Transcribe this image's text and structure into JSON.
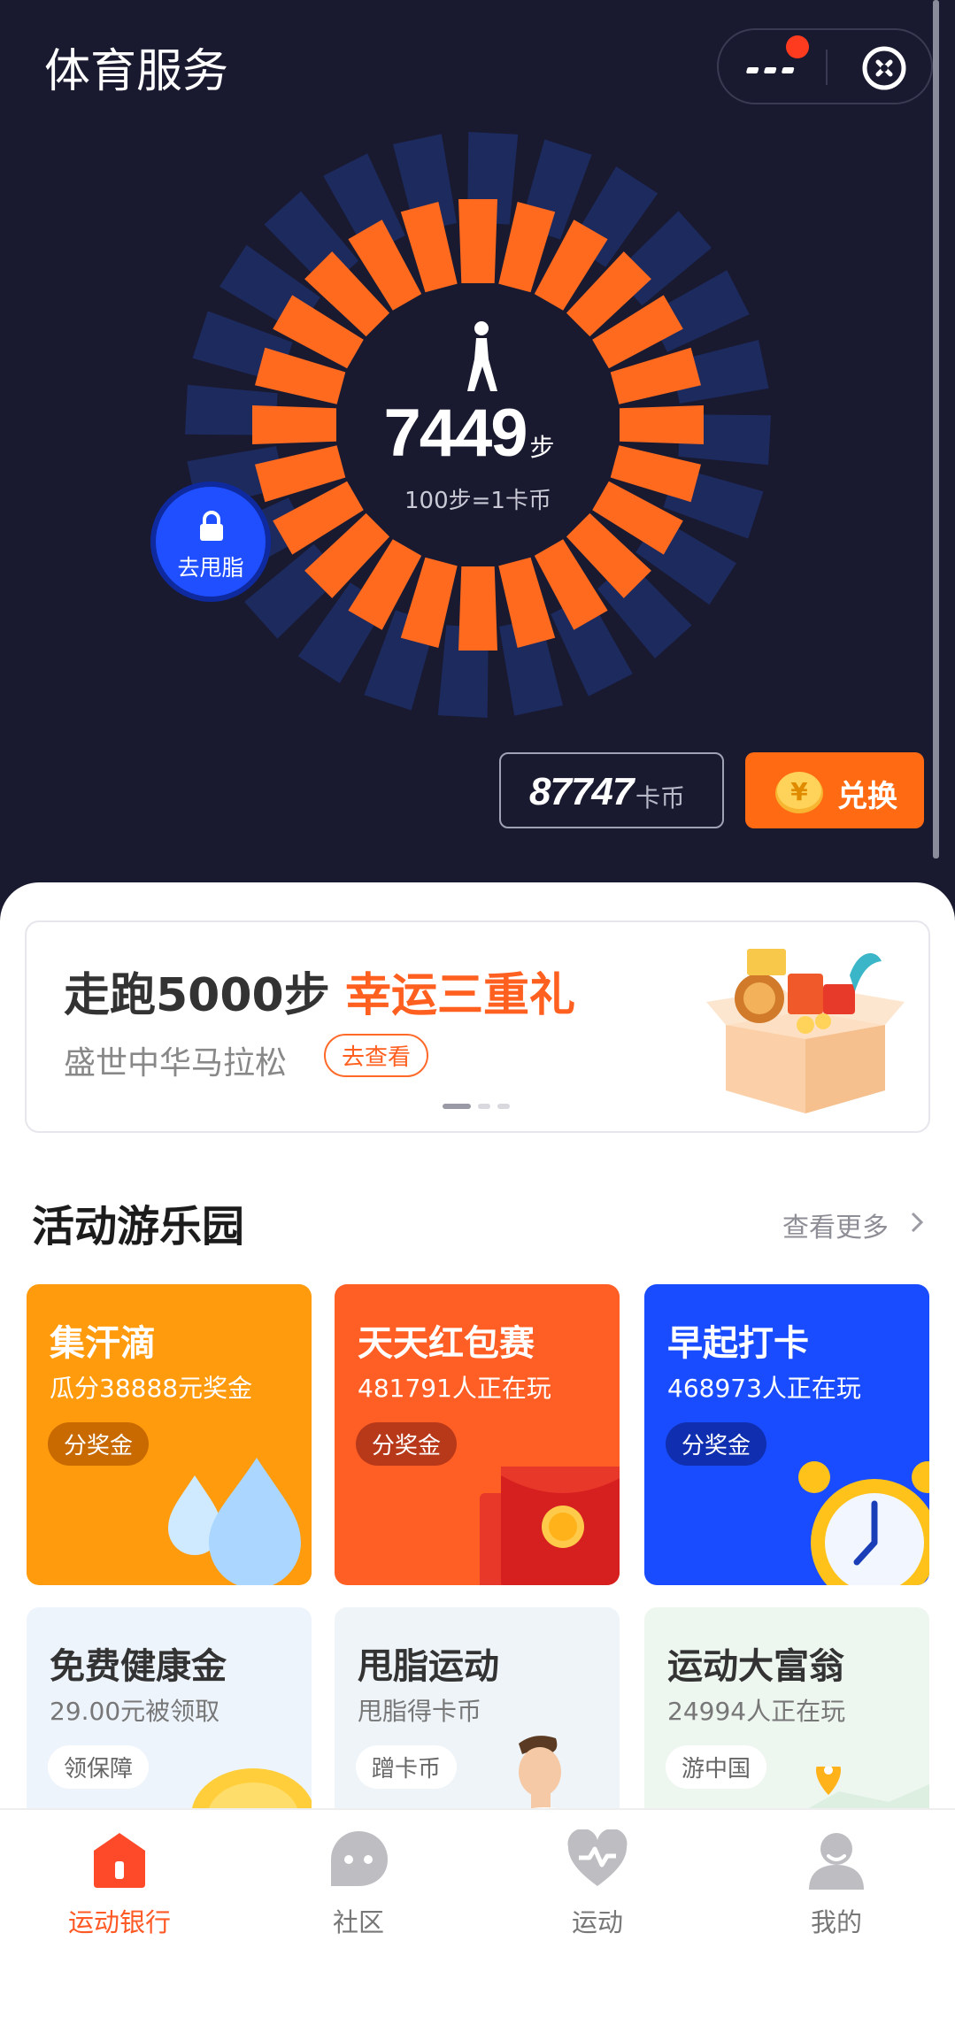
{
  "header": {
    "title": "体育服务"
  },
  "steps": {
    "value": "7449",
    "unit": "步",
    "rate": "100步=1卡币",
    "progress_fraction": 0.45
  },
  "lock_button": {
    "label": "去甩脂"
  },
  "balance": {
    "value": "87747",
    "unit": "卡币"
  },
  "exchange_button": {
    "label": "兑换"
  },
  "banner": {
    "title_black": "走跑5000步",
    "title_orange": "幸运三重礼",
    "subtitle": "盛世中华马拉松",
    "chip": "去查看",
    "active_page": 1,
    "page_count": 3
  },
  "section": {
    "title": "活动游乐园",
    "more": "查看更多"
  },
  "cards": [
    {
      "title": "集汗滴",
      "subtitle": "瓜分38888元奖金",
      "badge": "分奖金",
      "icon": "water-drop-icon"
    },
    {
      "title": "天天红包赛",
      "subtitle": "481791人正在玩",
      "badge": "分奖金",
      "icon": "red-envelope-icon"
    },
    {
      "title": "早起打卡",
      "subtitle": "468973人正在玩",
      "badge": "分奖金",
      "icon": "alarm-clock-icon"
    },
    {
      "title": "免费健康金",
      "subtitle": "29.00元被领取",
      "badge": "领保障",
      "icon": "gold-coin-icon"
    },
    {
      "title": "甩脂运动",
      "subtitle": "甩脂得卡币",
      "badge": "蹭卡币",
      "icon": "trainer-avatar-icon"
    },
    {
      "title": "运动大富翁",
      "subtitle": "24994人正在玩",
      "badge": "游中国",
      "icon": "map-pin-icon"
    }
  ],
  "tabs": [
    {
      "label": "运动银行",
      "icon": "bank-house-icon",
      "active": true
    },
    {
      "label": "社区",
      "icon": "chat-bubble-icon",
      "active": false
    },
    {
      "label": "运动",
      "icon": "heart-pulse-icon",
      "active": false
    },
    {
      "label": "我的",
      "icon": "person-icon",
      "active": false
    }
  ],
  "colors": {
    "hero_bg": "#191a30",
    "ring_active": "#ff6a1f",
    "ring_inactive": "#1d2a5e",
    "accent_orange": "#ff6a12",
    "accent_blue": "#1a4cff",
    "tab_active": "#ff5a25"
  }
}
